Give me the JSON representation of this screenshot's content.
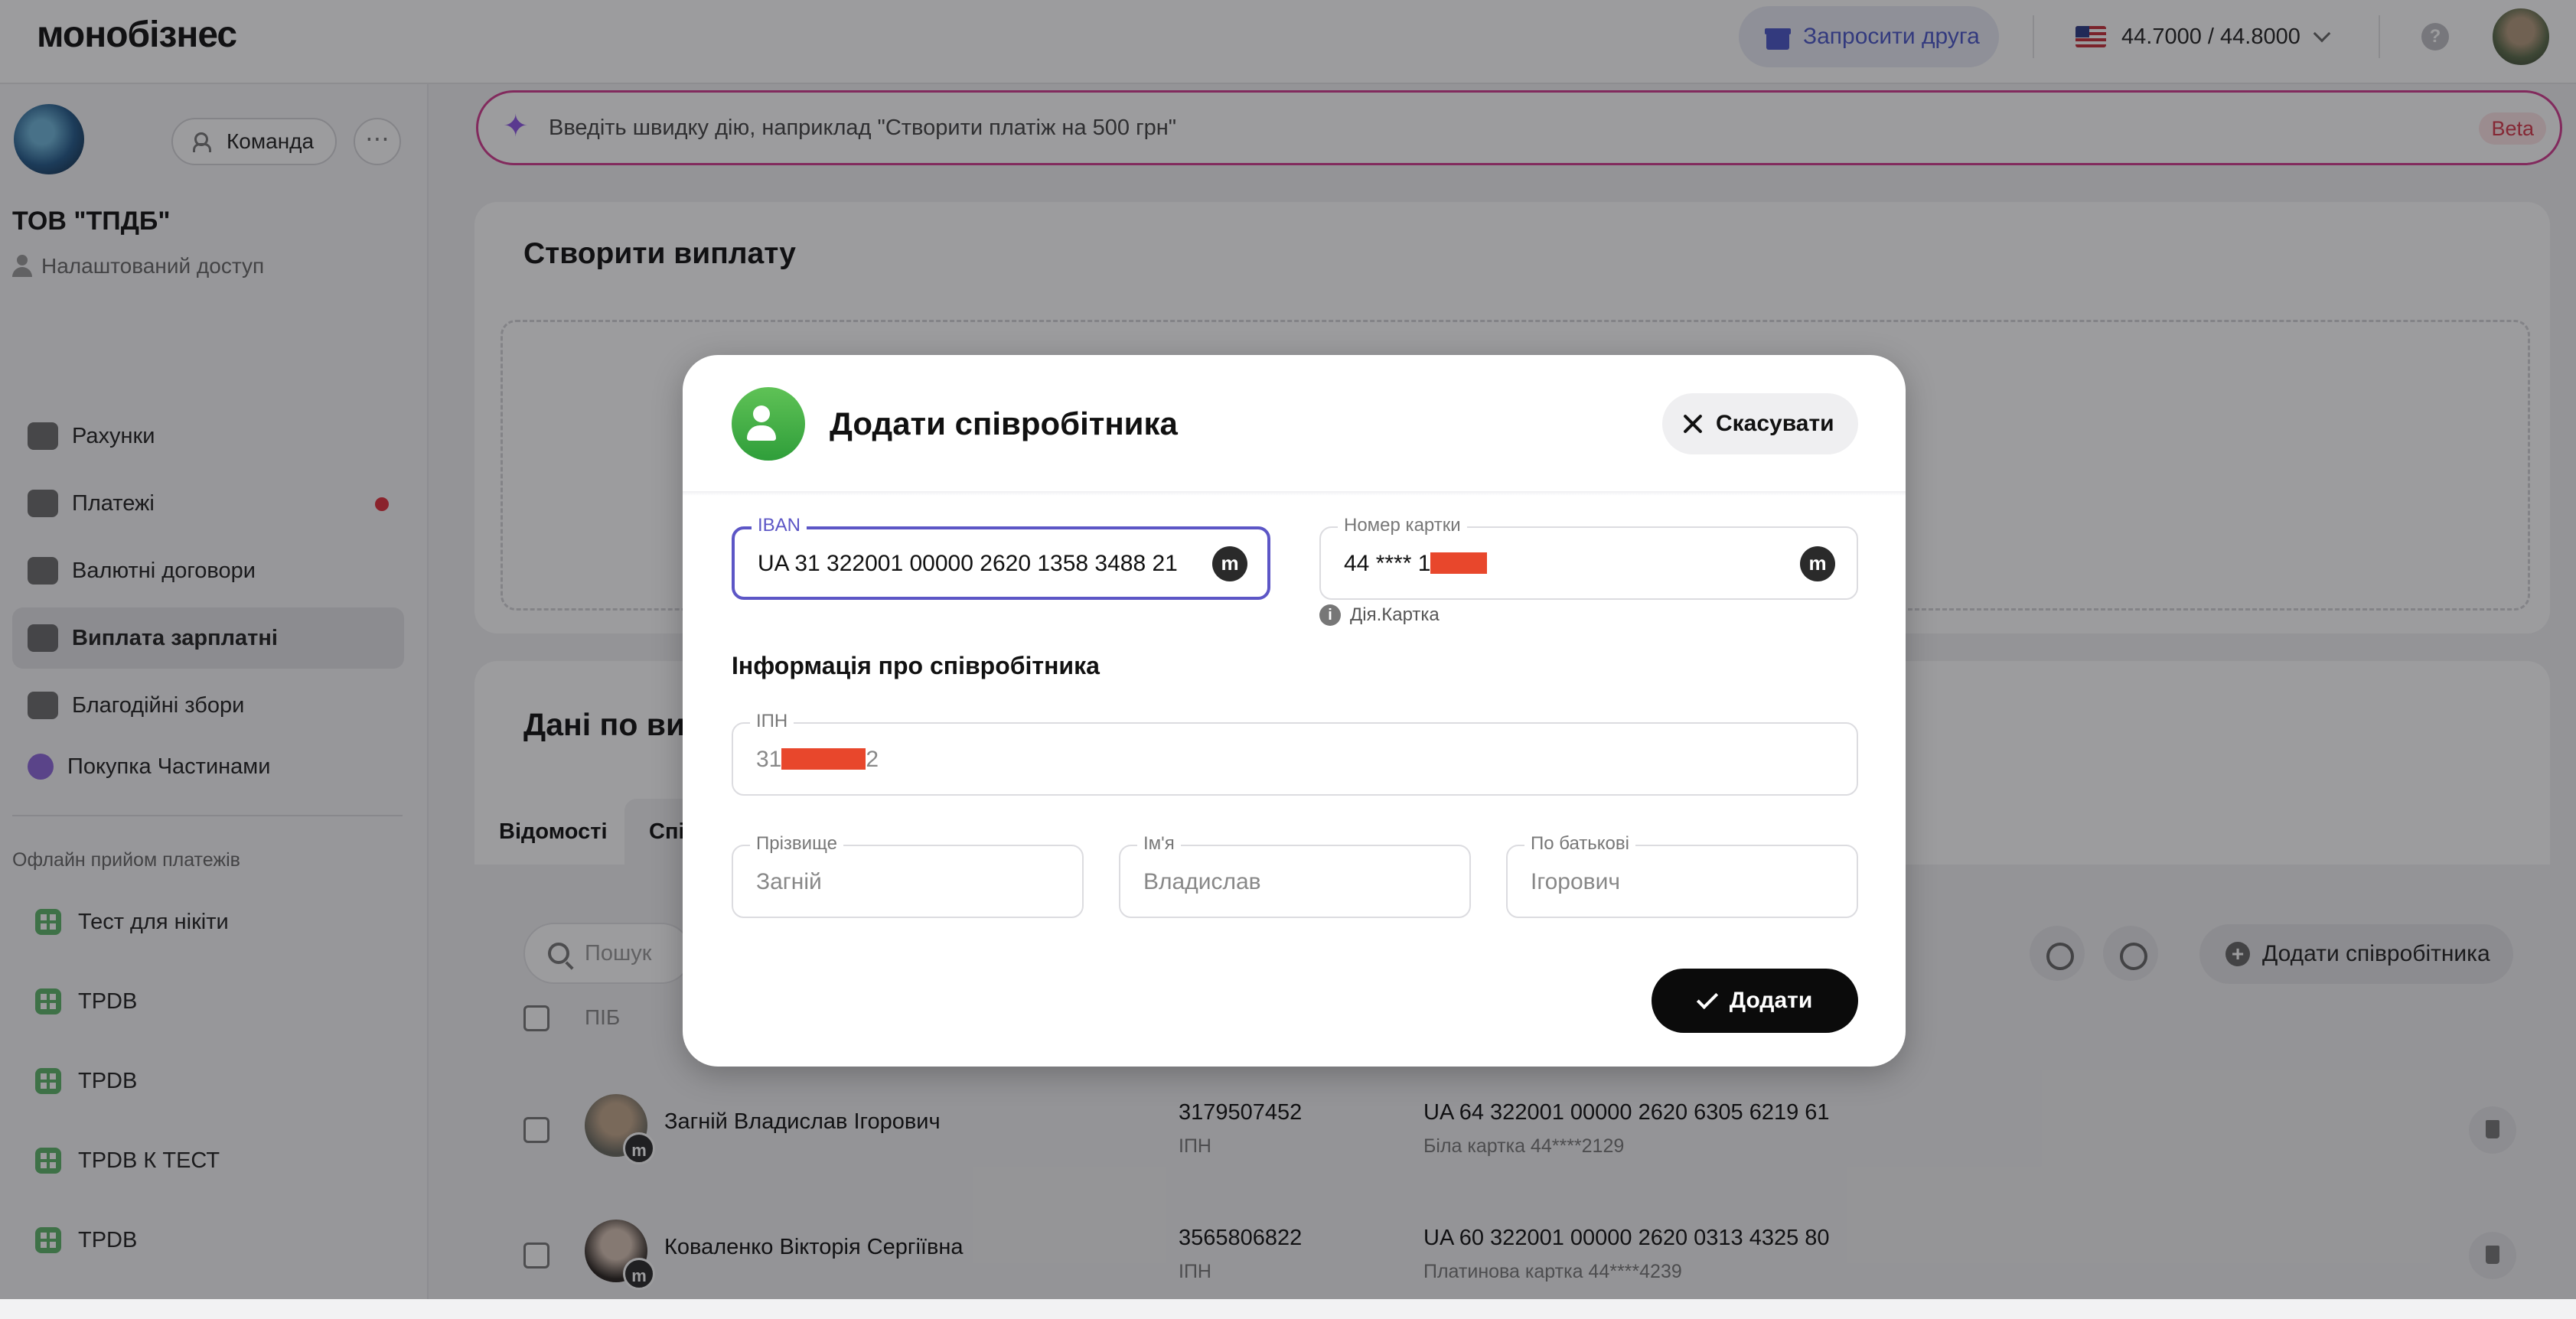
{
  "header": {
    "logo": "монобізнес",
    "invite_label": "Запросити друга",
    "exchange_rate": "44.7000 / 44.8000",
    "help_label": "?"
  },
  "sidebar": {
    "team_label": "Команда",
    "more_label": "⋯",
    "org_name": "ТОВ \"ТПДБ\"",
    "access_label": "Налаштований доступ",
    "nav": [
      {
        "label": "Рахунки",
        "icon": "wallet-icon"
      },
      {
        "label": "Платежі",
        "icon": "transfer-icon",
        "badge": true
      },
      {
        "label": "Валютні договори",
        "icon": "currency-icon"
      },
      {
        "label": "Виплата зарплатні",
        "icon": "salary-icon",
        "active": true
      },
      {
        "label": "Благодійні збори",
        "icon": "charity-icon"
      },
      {
        "label": "Покупка Частинами",
        "icon": "paw-icon"
      }
    ],
    "offline_title": "Офлайн прийом платежів",
    "pos": [
      {
        "label": "Тест для нікіти"
      },
      {
        "label": "TPDB"
      },
      {
        "label": "TPDB"
      },
      {
        "label": "TPDB К ТЕСТ"
      },
      {
        "label": "TPDB"
      },
      {
        "label": "TPDB"
      }
    ]
  },
  "quick_action": {
    "placeholder": "Введіть швидку дію, наприклад \"Створити платіж на 500 грн\"",
    "beta_label": "Beta"
  },
  "create_payout": {
    "title": "Створити виплату"
  },
  "data_section": {
    "title": "Дані по ви",
    "tabs": [
      "Відомості",
      "Спі"
    ],
    "search_placeholder": "Пошук",
    "add_employee_label": "Додати співробітника",
    "col_name": "ПІБ",
    "rows": [
      {
        "name": "Загній Владислав Ігорович",
        "inn": "3179507452",
        "inn_label": "ІПН",
        "iban": "UA 64 322001 00000 2620 6305 6219 61",
        "card": "Біла картка  44****2129"
      },
      {
        "name": "Коваленко Вікторія Сергіївна",
        "inn": "3565806822",
        "inn_label": "ІПН",
        "iban": "UA 60 322001 00000 2620 0313 4325 80",
        "card": "Платинова картка  44****4239"
      }
    ]
  },
  "modal": {
    "title": "Додати співробітника",
    "cancel_label": "Скасувати",
    "iban_label": "IBAN",
    "iban_value": "UA 31 322001 00000 2620 1358 3488 21",
    "card_label": "Номер картки",
    "card_value_prefix": "44 **** 1",
    "diia_label": "Дія.Картка",
    "section_title": "Інформація про співробітника",
    "inn_label": "ІПН",
    "inn_prefix": "31",
    "inn_suffix": "2",
    "surname_label": "Прізвище",
    "surname_value": "Загній",
    "name_label": "Ім'я",
    "name_value": "Владислав",
    "patronymic_label": "По батькові",
    "patronymic_value": "Ігорович",
    "submit_label": "Додати",
    "mono_badge": "m"
  },
  "colors": {
    "accent_focus": "#5c56c6",
    "success_green": "#2f9e3a",
    "quick_action_border": "#d33c8f",
    "redaction": "#e8472c"
  }
}
